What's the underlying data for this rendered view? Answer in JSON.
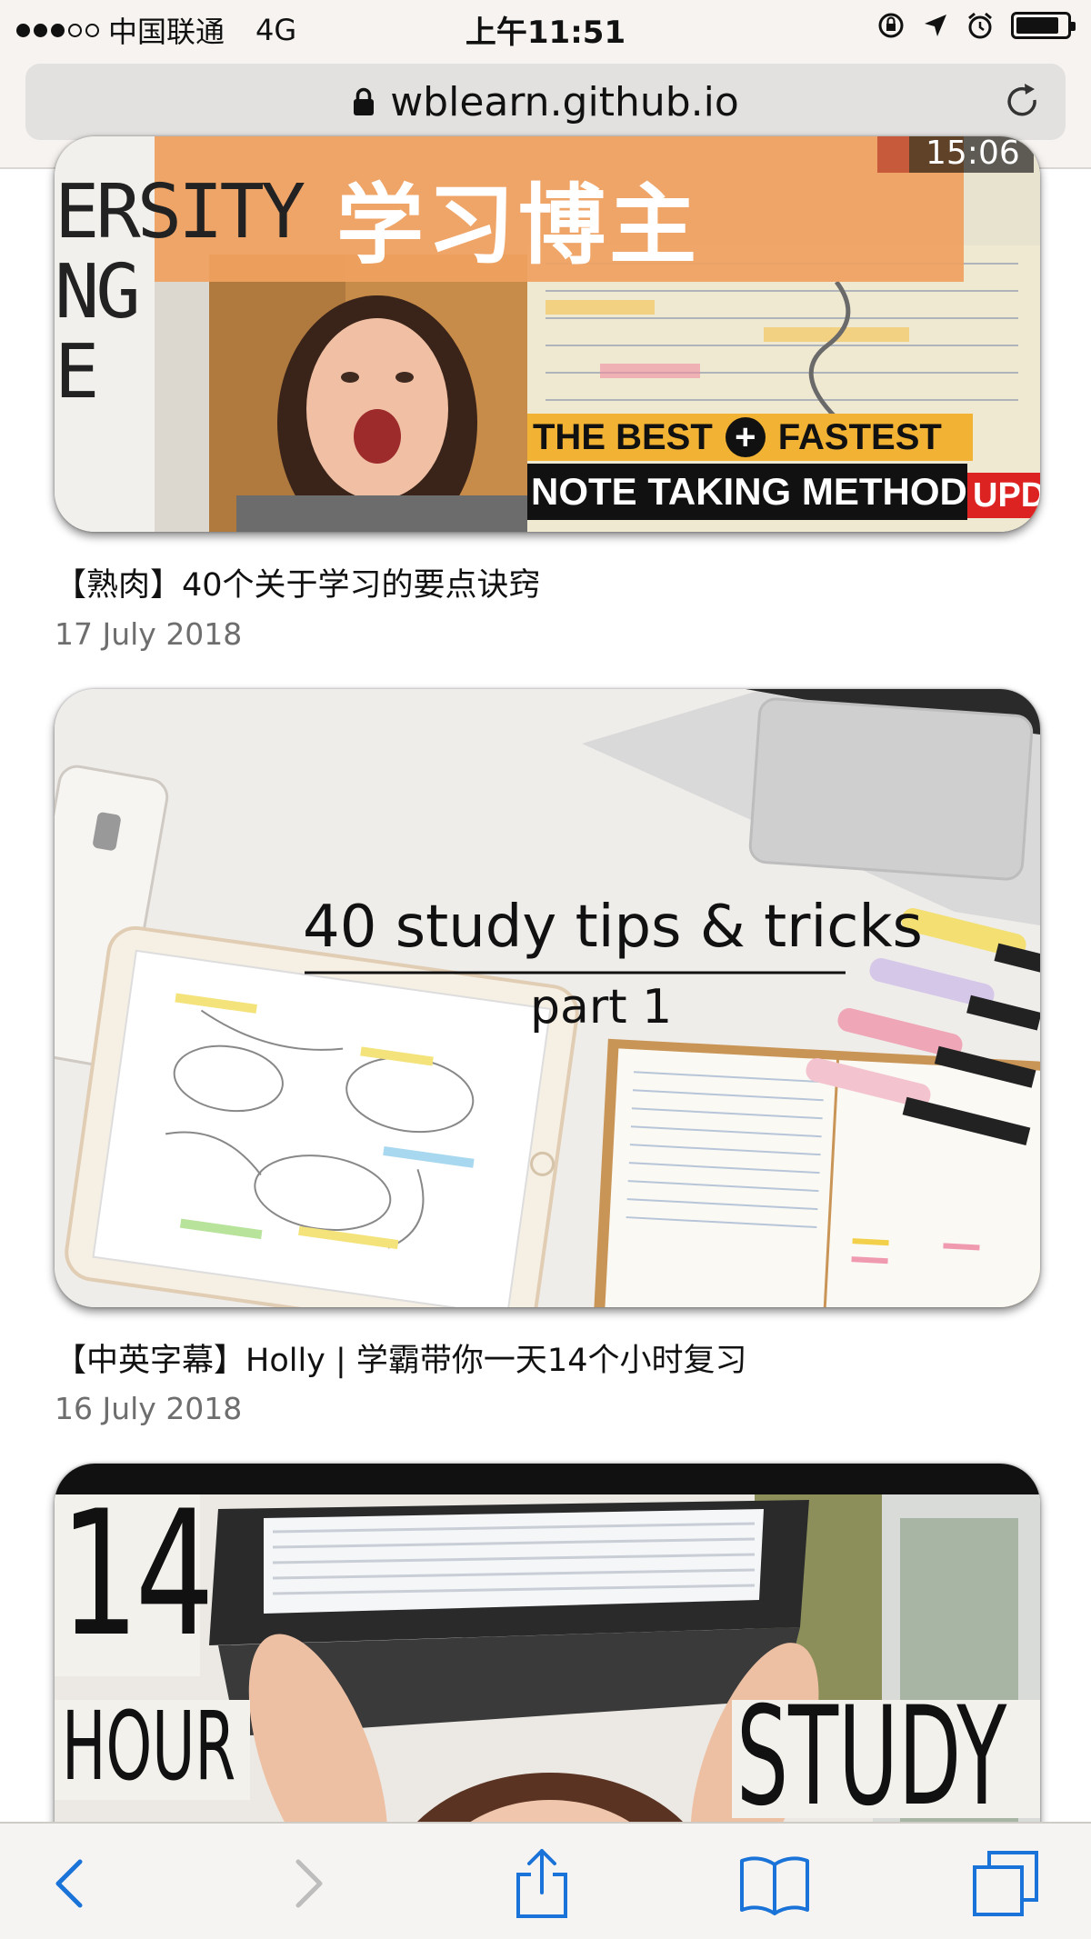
{
  "status_bar": {
    "carrier": "中国联通",
    "network": "4G",
    "time": "上午11:51"
  },
  "address_bar": {
    "url": "wblearn.github.io"
  },
  "posts": [
    {
      "thumb_text": {
        "banner": "学习博主",
        "duration": "15:06",
        "side_letters": [
          "ERSITY",
          "NG",
          "E"
        ],
        "overlay_line1": "THE BEST",
        "overlay_line1b": "FASTEST",
        "overlay_line2": "NOTE TAKING METHOD!",
        "corner": "UPDO"
      },
      "title": "【熟肉】40个关于学习的要点诀窍",
      "date": "17 July 2018"
    },
    {
      "thumb_text": {
        "headline": "40 study tips & tricks",
        "subline": "part 1"
      },
      "title": "【中英字幕】Holly | 学霸带你一天14个小时复习",
      "date": "16 July 2018"
    },
    {
      "thumb_text": {
        "number": "14",
        "left_word": "HOUR",
        "right_word": "STUDY"
      }
    }
  ],
  "toolbar": {
    "icons": [
      "back-icon",
      "forward-icon",
      "share-icon",
      "bookmarks-icon",
      "tabs-icon"
    ]
  },
  "colors": {
    "accent_blue": "#1a73d9",
    "banner_orange": "#f0a060",
    "overlay_yellow": "#f2b234",
    "date_gray": "#6e6e6e"
  }
}
